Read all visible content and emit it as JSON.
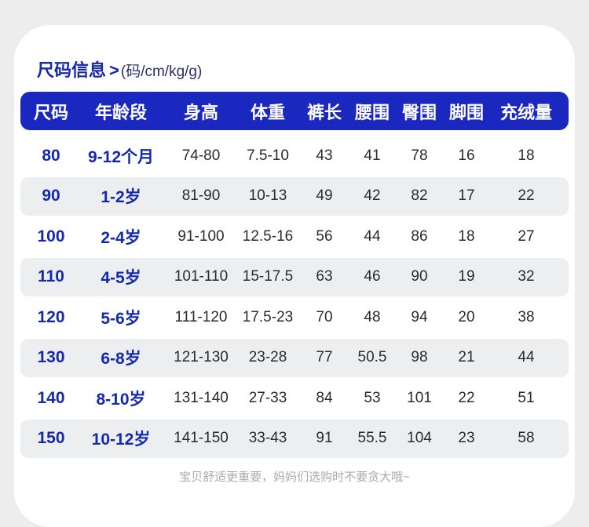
{
  "heading": {
    "title": "尺码信息",
    "arrow": ">",
    "units": "(码/cm/kg/g)"
  },
  "chart_data": {
    "type": "table",
    "columns": [
      "尺码",
      "年龄段",
      "身高",
      "体重",
      "裤长",
      "腰围",
      "臀围",
      "脚围",
      "充绒量"
    ],
    "rows": [
      [
        "80",
        "9-12个月",
        "74-80",
        "7.5-10",
        "43",
        "41",
        "78",
        "16",
        "18"
      ],
      [
        "90",
        "1-2岁",
        "81-90",
        "10-13",
        "49",
        "42",
        "82",
        "17",
        "22"
      ],
      [
        "100",
        "2-4岁",
        "91-100",
        "12.5-16",
        "56",
        "44",
        "86",
        "18",
        "27"
      ],
      [
        "110",
        "4-5岁",
        "101-110",
        "15-17.5",
        "63",
        "46",
        "90",
        "19",
        "32"
      ],
      [
        "120",
        "5-6岁",
        "111-120",
        "17.5-23",
        "70",
        "48",
        "94",
        "20",
        "38"
      ],
      [
        "130",
        "6-8岁",
        "121-130",
        "23-28",
        "77",
        "50.5",
        "98",
        "21",
        "44"
      ],
      [
        "140",
        "8-10岁",
        "131-140",
        "27-33",
        "84",
        "53",
        "101",
        "22",
        "51"
      ],
      [
        "150",
        "10-12岁",
        "141-150",
        "33-43",
        "91",
        "55.5",
        "104",
        "23",
        "58"
      ]
    ]
  },
  "footer_note": "宝贝舒适更重要，妈妈们选购时不要贪大哦~",
  "colors": {
    "header_background": "#1a28c0",
    "accent_text": "#1528b0",
    "row_shade": "#eceef0"
  }
}
